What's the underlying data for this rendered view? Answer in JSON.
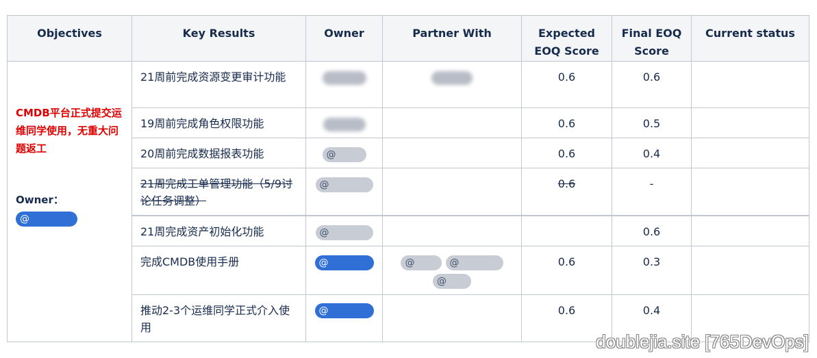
{
  "table": {
    "headers": {
      "objectives": "Objectives",
      "key_results": "Key Results",
      "owner": "Owner",
      "partner": "Partner With",
      "expected": "Expected EOQ Score",
      "final": "Final EOQ Score",
      "status": "Current status"
    },
    "objective": {
      "text": "CMDB平台正式提交运维同学使用，无重大问题返工",
      "owner_label": "Owner："
    },
    "rows": [
      {
        "kr": "21周前完成资源变更审计功能",
        "expected": "0.6",
        "final": "0.6"
      },
      {
        "kr": "19周前完成角色权限功能",
        "expected": "0.6",
        "final": "0.5"
      },
      {
        "kr": "20周前完成数据报表功能",
        "expected": "0.6",
        "final": "0.4"
      },
      {
        "kr": "21周完成工单管理功能（5/9讨论任务调整）",
        "expected": "0.6",
        "final": "-"
      },
      {
        "kr": "21周完成资产初始化功能",
        "expected": "",
        "final": "0.6"
      },
      {
        "kr": "完成CMDB使用手册",
        "expected": "0.6",
        "final": "0.3"
      },
      {
        "kr": "推动2-3个运维同学正式介入使用",
        "expected": "0.6",
        "final": "0.4"
      }
    ],
    "mention_symbol": "@"
  },
  "watermark": "doublejia.site [765DevOps]",
  "colors": {
    "header_bg": "#f4f5f7",
    "border": "#c1c7d0",
    "objective_red": "#de0000",
    "mention_blue": "#2f6fd6"
  }
}
